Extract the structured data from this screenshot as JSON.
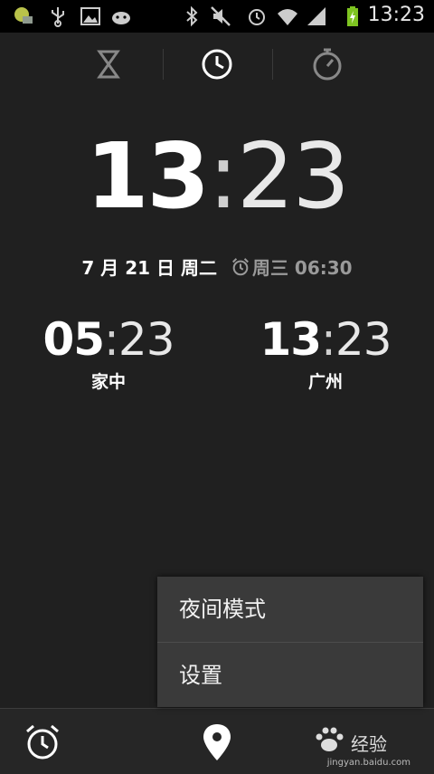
{
  "status_bar": {
    "time": "13:23",
    "icons": [
      "sim-icon",
      "usb-icon",
      "picture-icon",
      "android-icon",
      "bluetooth-icon",
      "mute-icon",
      "alarm-icon",
      "wifi-icon",
      "signal-icon",
      "battery-icon"
    ],
    "battery_color": "#7ec421"
  },
  "tabs": [
    {
      "name": "timer",
      "icon": "hourglass-icon",
      "active": false
    },
    {
      "name": "clock",
      "icon": "clock-icon",
      "active": true
    },
    {
      "name": "stopwatch",
      "icon": "stopwatch-icon",
      "active": false
    }
  ],
  "clock": {
    "hours": "13",
    "separator": ":",
    "minutes": "23",
    "date": "7 月 21 日 周二",
    "next_alarm": "周三 06:30"
  },
  "world_clocks": [
    {
      "hours": "05",
      "minutes": "23",
      "city": "家中"
    },
    {
      "hours": "13",
      "minutes": "23",
      "city": "广州"
    }
  ],
  "menu": {
    "items": [
      "夜间模式",
      "设置"
    ]
  },
  "bottom_bar": {
    "buttons": [
      "alarm-icon",
      "location-pin-icon",
      "more-icon"
    ]
  },
  "watermark": {
    "text": "经验",
    "url": "jingyan.baidu.com"
  }
}
